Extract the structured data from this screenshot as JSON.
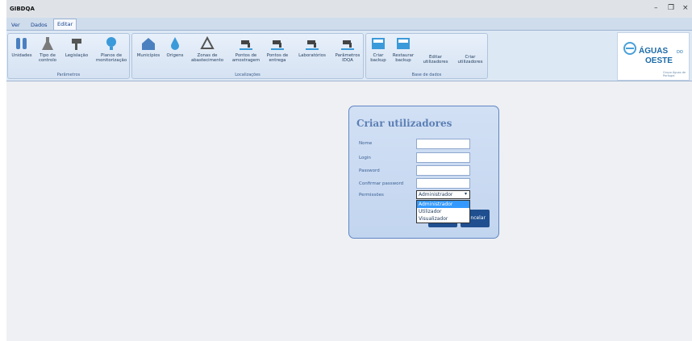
{
  "app": {
    "title": "GIBDQA"
  },
  "window_controls": {
    "minimize": "–",
    "maximize": "❐",
    "close": "×"
  },
  "tabs": [
    "Ver",
    "Dados",
    "Editar"
  ],
  "ribbon": {
    "groups": [
      {
        "label": "Parâmetros",
        "buttons": [
          "Unidades",
          "Tipo de controlo",
          "Legislação",
          "Planos de monitorização"
        ]
      },
      {
        "label": "Localizações",
        "buttons": [
          "Municípios",
          "Origens",
          "Zonas de abastecimento",
          "Pontos de amostragem",
          "Pontos de entrega",
          "Laboratórios",
          "Parâmetros IDQA"
        ]
      },
      {
        "label": "Base de dados",
        "buttons": [
          "Criar backup",
          "Restaurar backup",
          "Editar utilizadores",
          "Criar utilizadores"
        ]
      }
    ]
  },
  "logo": {
    "line1": "ÁGUAS",
    "do": "DO",
    "line2": "OESTE",
    "sub": "Grupo Águas de Portugal"
  },
  "dialog": {
    "title": "Criar utilizadores",
    "fields": [
      {
        "label": "Nome",
        "value": ""
      },
      {
        "label": "Login",
        "value": ""
      },
      {
        "label": "Password",
        "value": ""
      },
      {
        "label": "Confirmar password",
        "value": ""
      }
    ],
    "permissions_label": "Permissões",
    "permissions_selected": "Administrador",
    "permissions_options": [
      "Administrador",
      "Utilizador",
      "Visualizador"
    ],
    "button_label": "ncelar"
  },
  "colors": {
    "accent": "#1f4f8f",
    "selection": "#3399ff",
    "dialog_bg": "#c9daf2"
  }
}
